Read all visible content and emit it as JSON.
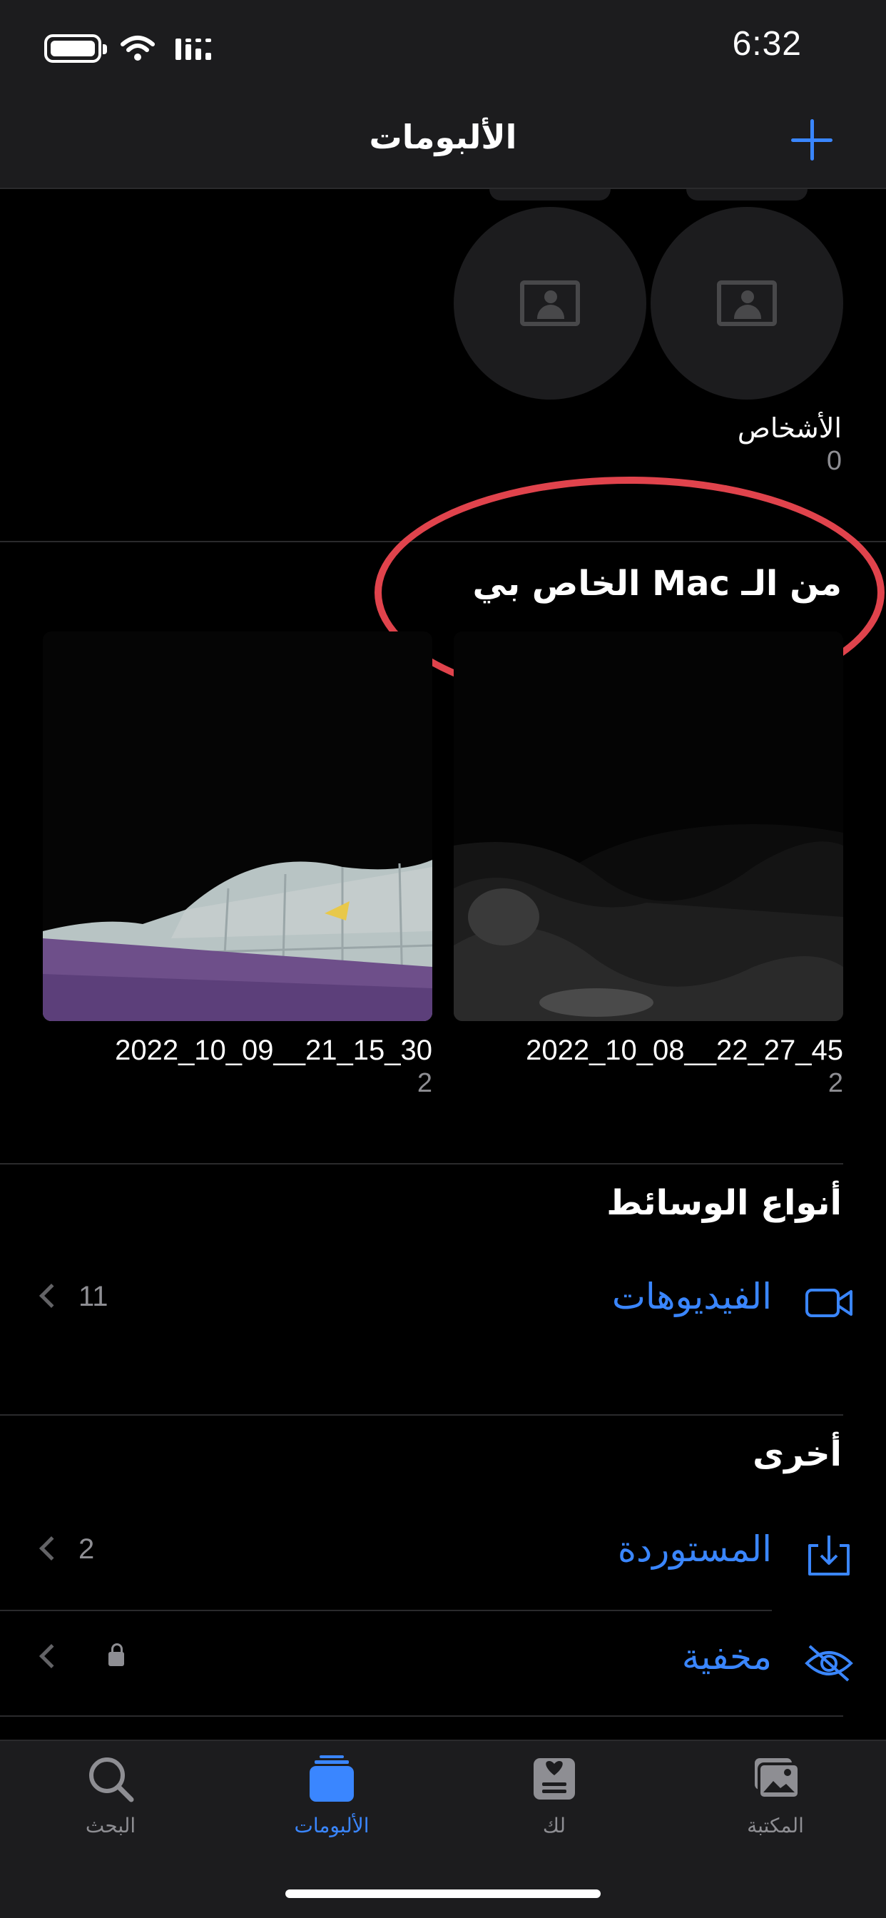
{
  "status_bar": {
    "time": "6:32"
  },
  "nav": {
    "title": "الألبومات"
  },
  "people": {
    "label": "الأشخاص",
    "count": "0"
  },
  "from_my_mac": {
    "title": "من الـ Mac الخاص بي",
    "albums": [
      {
        "name": "2022_10_08__22_27_45",
        "count": "2"
      },
      {
        "name": "2022_10_09__21_15_30",
        "count": "2"
      }
    ]
  },
  "media_types": {
    "title": "أنواع الوسائط",
    "items": [
      {
        "label": "الفيديوهات",
        "count": "11",
        "icon": "video-camera-icon"
      }
    ]
  },
  "other": {
    "title": "أخرى",
    "items": [
      {
        "label": "المستوردة",
        "count": "2",
        "icon": "import-tray-icon"
      },
      {
        "label": "مخفية",
        "icon": "eye-slash-icon",
        "locked": true
      }
    ]
  },
  "tabs": [
    {
      "label": "المكتبة",
      "icon": "photo-library-icon"
    },
    {
      "label": "لك",
      "icon": "for-you-icon"
    },
    {
      "label": "الألبومات",
      "icon": "albums-icon",
      "active": true
    },
    {
      "label": "البحث",
      "icon": "search-icon"
    }
  ],
  "colors": {
    "accent": "#3a86ff",
    "highlight_ring": "#e0434c",
    "background": "#000000",
    "bar": "#1c1c1e"
  }
}
